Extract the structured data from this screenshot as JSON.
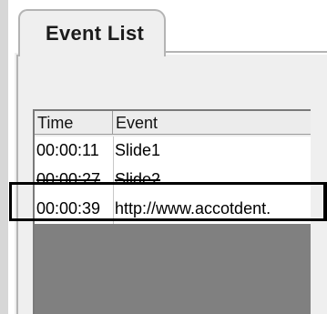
{
  "tab": {
    "label": "Event List"
  },
  "list": {
    "columns": [
      "Time",
      "Event"
    ],
    "rows": [
      {
        "time": "00:00:11",
        "event": "Slide1"
      },
      {
        "time": "00:00:27",
        "event": "Slide2"
      },
      {
        "time": "00:00:39",
        "event": "http://www.accotdent."
      }
    ]
  },
  "colors": {
    "panel": "#efefef",
    "list_empty": "#808080",
    "highlight": "#000000"
  }
}
